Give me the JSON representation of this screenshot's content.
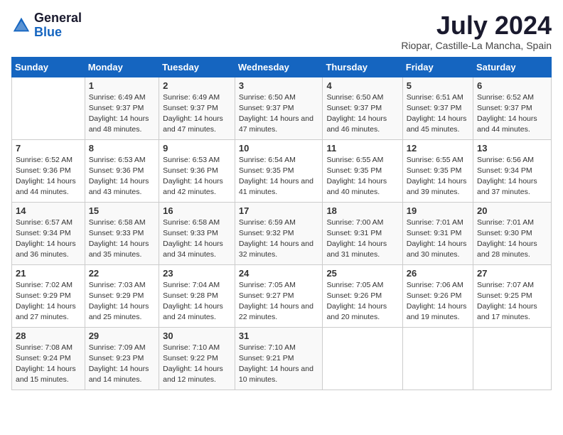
{
  "header": {
    "logo_line1": "General",
    "logo_line2": "Blue",
    "month": "July 2024",
    "location": "Riopar, Castille-La Mancha, Spain"
  },
  "days_of_week": [
    "Sunday",
    "Monday",
    "Tuesday",
    "Wednesday",
    "Thursday",
    "Friday",
    "Saturday"
  ],
  "weeks": [
    [
      {
        "day": "",
        "info": ""
      },
      {
        "day": "1",
        "info": "Sunrise: 6:49 AM\nSunset: 9:37 PM\nDaylight: 14 hours\nand 48 minutes."
      },
      {
        "day": "2",
        "info": "Sunrise: 6:49 AM\nSunset: 9:37 PM\nDaylight: 14 hours\nand 47 minutes."
      },
      {
        "day": "3",
        "info": "Sunrise: 6:50 AM\nSunset: 9:37 PM\nDaylight: 14 hours\nand 47 minutes."
      },
      {
        "day": "4",
        "info": "Sunrise: 6:50 AM\nSunset: 9:37 PM\nDaylight: 14 hours\nand 46 minutes."
      },
      {
        "day": "5",
        "info": "Sunrise: 6:51 AM\nSunset: 9:37 PM\nDaylight: 14 hours\nand 45 minutes."
      },
      {
        "day": "6",
        "info": "Sunrise: 6:52 AM\nSunset: 9:37 PM\nDaylight: 14 hours\nand 44 minutes."
      }
    ],
    [
      {
        "day": "7",
        "info": "Sunrise: 6:52 AM\nSunset: 9:36 PM\nDaylight: 14 hours\nand 44 minutes."
      },
      {
        "day": "8",
        "info": "Sunrise: 6:53 AM\nSunset: 9:36 PM\nDaylight: 14 hours\nand 43 minutes."
      },
      {
        "day": "9",
        "info": "Sunrise: 6:53 AM\nSunset: 9:36 PM\nDaylight: 14 hours\nand 42 minutes."
      },
      {
        "day": "10",
        "info": "Sunrise: 6:54 AM\nSunset: 9:35 PM\nDaylight: 14 hours\nand 41 minutes."
      },
      {
        "day": "11",
        "info": "Sunrise: 6:55 AM\nSunset: 9:35 PM\nDaylight: 14 hours\nand 40 minutes."
      },
      {
        "day": "12",
        "info": "Sunrise: 6:55 AM\nSunset: 9:35 PM\nDaylight: 14 hours\nand 39 minutes."
      },
      {
        "day": "13",
        "info": "Sunrise: 6:56 AM\nSunset: 9:34 PM\nDaylight: 14 hours\nand 37 minutes."
      }
    ],
    [
      {
        "day": "14",
        "info": "Sunrise: 6:57 AM\nSunset: 9:34 PM\nDaylight: 14 hours\nand 36 minutes."
      },
      {
        "day": "15",
        "info": "Sunrise: 6:58 AM\nSunset: 9:33 PM\nDaylight: 14 hours\nand 35 minutes."
      },
      {
        "day": "16",
        "info": "Sunrise: 6:58 AM\nSunset: 9:33 PM\nDaylight: 14 hours\nand 34 minutes."
      },
      {
        "day": "17",
        "info": "Sunrise: 6:59 AM\nSunset: 9:32 PM\nDaylight: 14 hours\nand 32 minutes."
      },
      {
        "day": "18",
        "info": "Sunrise: 7:00 AM\nSunset: 9:31 PM\nDaylight: 14 hours\nand 31 minutes."
      },
      {
        "day": "19",
        "info": "Sunrise: 7:01 AM\nSunset: 9:31 PM\nDaylight: 14 hours\nand 30 minutes."
      },
      {
        "day": "20",
        "info": "Sunrise: 7:01 AM\nSunset: 9:30 PM\nDaylight: 14 hours\nand 28 minutes."
      }
    ],
    [
      {
        "day": "21",
        "info": "Sunrise: 7:02 AM\nSunset: 9:29 PM\nDaylight: 14 hours\nand 27 minutes."
      },
      {
        "day": "22",
        "info": "Sunrise: 7:03 AM\nSunset: 9:29 PM\nDaylight: 14 hours\nand 25 minutes."
      },
      {
        "day": "23",
        "info": "Sunrise: 7:04 AM\nSunset: 9:28 PM\nDaylight: 14 hours\nand 24 minutes."
      },
      {
        "day": "24",
        "info": "Sunrise: 7:05 AM\nSunset: 9:27 PM\nDaylight: 14 hours\nand 22 minutes."
      },
      {
        "day": "25",
        "info": "Sunrise: 7:05 AM\nSunset: 9:26 PM\nDaylight: 14 hours\nand 20 minutes."
      },
      {
        "day": "26",
        "info": "Sunrise: 7:06 AM\nSunset: 9:26 PM\nDaylight: 14 hours\nand 19 minutes."
      },
      {
        "day": "27",
        "info": "Sunrise: 7:07 AM\nSunset: 9:25 PM\nDaylight: 14 hours\nand 17 minutes."
      }
    ],
    [
      {
        "day": "28",
        "info": "Sunrise: 7:08 AM\nSunset: 9:24 PM\nDaylight: 14 hours\nand 15 minutes."
      },
      {
        "day": "29",
        "info": "Sunrise: 7:09 AM\nSunset: 9:23 PM\nDaylight: 14 hours\nand 14 minutes."
      },
      {
        "day": "30",
        "info": "Sunrise: 7:10 AM\nSunset: 9:22 PM\nDaylight: 14 hours\nand 12 minutes."
      },
      {
        "day": "31",
        "info": "Sunrise: 7:10 AM\nSunset: 9:21 PM\nDaylight: 14 hours\nand 10 minutes."
      },
      {
        "day": "",
        "info": ""
      },
      {
        "day": "",
        "info": ""
      },
      {
        "day": "",
        "info": ""
      }
    ]
  ]
}
